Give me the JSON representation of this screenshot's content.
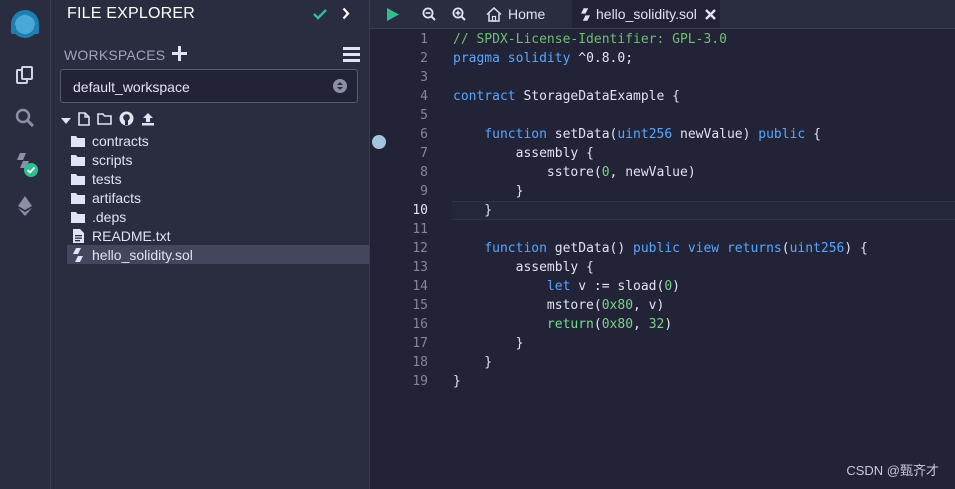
{
  "explorer": {
    "title": "FILE EXPLORER",
    "workspaces_label": "WORKSPACES",
    "workspace_selected": "default_workspace",
    "items": [
      {
        "name": "contracts",
        "type": "folder"
      },
      {
        "name": "scripts",
        "type": "folder"
      },
      {
        "name": "tests",
        "type": "folder"
      },
      {
        "name": "artifacts",
        "type": "folder"
      },
      {
        "name": ".deps",
        "type": "folder"
      },
      {
        "name": "README.txt",
        "type": "file"
      },
      {
        "name": "hello_solidity.sol",
        "type": "solidity",
        "selected": true
      }
    ]
  },
  "tabs": [
    {
      "label": "Home",
      "icon": "home-icon"
    },
    {
      "label": "hello_solidity.sol",
      "icon": "solidity-icon",
      "active": true
    }
  ],
  "editor": {
    "current_line": 10,
    "lines": [
      {
        "n": "1",
        "text": "// SPDX-License-Identifier: GPL-3.0"
      },
      {
        "n": "2",
        "text": "pragma solidity ^0.8.0;"
      },
      {
        "n": "3",
        "text": ""
      },
      {
        "n": "4",
        "text": "contract StorageDataExample {"
      },
      {
        "n": "5",
        "text": ""
      },
      {
        "n": "6",
        "text": "    function setData(uint256 newValue) public {"
      },
      {
        "n": "7",
        "text": "        assembly {"
      },
      {
        "n": "8",
        "text": "            sstore(0, newValue)"
      },
      {
        "n": "9",
        "text": "        }"
      },
      {
        "n": "10",
        "text": "    }"
      },
      {
        "n": "11",
        "text": ""
      },
      {
        "n": "12",
        "text": "    function getData() public view returns(uint256) {"
      },
      {
        "n": "13",
        "text": "        assembly {"
      },
      {
        "n": "14",
        "text": "            let v := sload(0)"
      },
      {
        "n": "15",
        "text": "            mstore(0x80, v)"
      },
      {
        "n": "16",
        "text": "            return(0x80, 32)"
      },
      {
        "n": "17",
        "text": "        }"
      },
      {
        "n": "18",
        "text": "    }"
      },
      {
        "n": "19",
        "text": "}"
      }
    ]
  },
  "watermark": "CSDN @甄齐才",
  "colors": {
    "background": "#222336",
    "panel": "#2a2c3f",
    "accent_green": "#2fbe8f",
    "keyword": "#58a7ff",
    "comment": "#6fbf73"
  }
}
